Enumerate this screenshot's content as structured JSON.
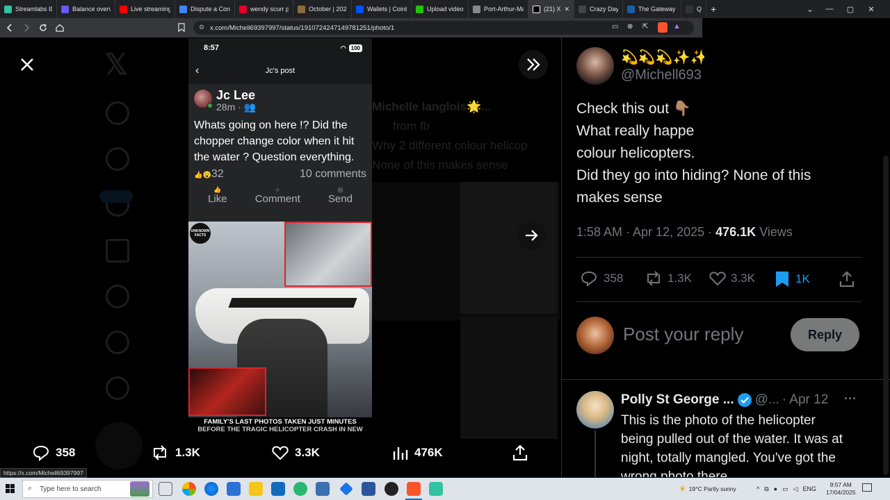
{
  "browser": {
    "tabs": [
      {
        "title": "Streamlabs ID",
        "color": "#31c3a2"
      },
      {
        "title": "Balance overvie",
        "color": "#635bff"
      },
      {
        "title": "Live streaming",
        "color": "#ff0000"
      },
      {
        "title": "Dispute a Cont",
        "color": "#4285f4"
      },
      {
        "title": "wendy scurr pe",
        "color": "#e60023"
      },
      {
        "title": "October | 2024",
        "color": "#8a6d3b"
      },
      {
        "title": "Wallets | Coinb",
        "color": "#0052ff"
      },
      {
        "title": "Upload videos",
        "color": "#21c40a"
      },
      {
        "title": "Port-Arthur-Ma",
        "color": "#888888"
      },
      {
        "title": "(21) X",
        "color": "#000000",
        "active": true
      },
      {
        "title": "Crazy Days and",
        "color": "#444444"
      },
      {
        "title": "The Gateway P",
        "color": "#1a5da6"
      },
      {
        "title": "Q",
        "color": "#333333"
      }
    ],
    "new_tab": "+",
    "url": "x.com/Michell69397997/status/1910724247149781251/photo/1",
    "status_url": "https://x.com/Michell69397997"
  },
  "viewer": {
    "close_icon": "close-icon",
    "expand_icon": "double-chevron-right-icon",
    "next_icon": "arrow-right-icon"
  },
  "phone": {
    "time": "8:57",
    "battery": "100",
    "header": "Jc's post",
    "author": "Jc Lee",
    "meta": "28m ·",
    "text": "Whats going on here !? Did the chopper change color when it hit the water ? Question everything.",
    "reactions": "32",
    "comments": "10 comments",
    "actions": [
      "Like",
      "Comment",
      "Send"
    ],
    "image_watermark": "UNKNOWN FACTS",
    "image_caption": "FAMILY'S LAST PHOTOS TAKEN JUST MINUTES",
    "image_caption_2": "BEFORE THE TRAGIC HELICOPTER CRASH IN NEW"
  },
  "background_tweet": {
    "name": "Michelle langlois🌟...",
    "line1": "from fb",
    "line2": "Why 2 different colour helicop",
    "line3": "None of this makes sense"
  },
  "tweet": {
    "display_name": "💫💫💫✨✨",
    "handle": "@Michell693",
    "lines": [
      "Check this out 👇🏽",
      "What really happe",
      "colour helicopters.",
      "Did they go into hiding? None of this",
      "makes sense"
    ],
    "time": "1:58 AM · Apr 12, 2025 ·",
    "views_count": "476.1K",
    "views_label": "Views",
    "replies": "358",
    "reposts": "1.3K",
    "likes": "3.3K",
    "bookmarks": "1K",
    "bookmark_color": "#1d9bf0"
  },
  "reply_box": {
    "placeholder": "Post your reply",
    "button": "Reply"
  },
  "reply": {
    "name": "Polly St George ...",
    "handle": "@...",
    "date": "· Apr 12",
    "more": "···",
    "lines": [
      "This is the photo of the helicopter",
      "being pulled out of the water. It was at",
      "night, totally mangled. You've got the",
      "wrong photo there"
    ]
  },
  "bottom_bar": {
    "replies": "358",
    "reposts": "1.3K",
    "likes": "3.3K",
    "views": "476K"
  },
  "taskbar": {
    "search_placeholder": "Type here to search",
    "weather": "19°C  Partly sunny",
    "lang": "ENG",
    "time": "9:57 AM",
    "date": "17/04/2025"
  }
}
